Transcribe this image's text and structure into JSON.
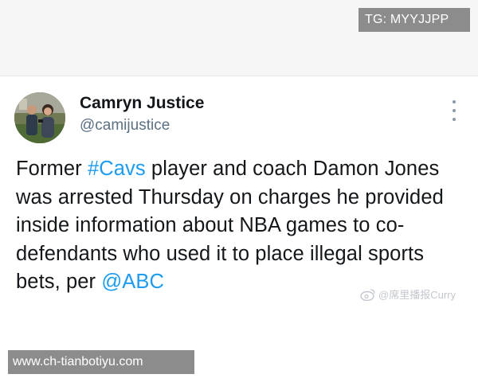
{
  "overlay": {
    "tg_label": "TG: MYYJJPP",
    "site_label": "www.ch-tianbotiyu.com"
  },
  "tweet": {
    "author": {
      "display_name": "Camryn Justice",
      "handle": "@camijustice"
    },
    "body": {
      "part1": "Former ",
      "hashtag": "#Cavs",
      "part2": " player and coach Damon Jones was arrested Thursday on charges he provided inside information about NBA games to co-defendants who used it to place illegal sports bets, per ",
      "mention": "@ABC"
    },
    "link_color": "#1d9bf0"
  },
  "watermark": {
    "text": "@席里播报Curry",
    "icon": "weibo-icon"
  }
}
